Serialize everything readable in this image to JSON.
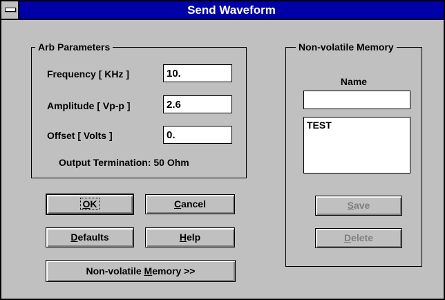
{
  "window": {
    "title": "Send Waveform"
  },
  "arb": {
    "title": "Arb Parameters",
    "frequency": {
      "label": "Frequency [ KHz ]",
      "value": "10."
    },
    "amplitude": {
      "label": "Amplitude [ Vp-p ]",
      "value": "2.6"
    },
    "offset": {
      "label": "Offset [ Volts ]",
      "value": "0."
    },
    "termination": "Output Termination: 50 Ohm"
  },
  "buttons": {
    "ok": {
      "access": "O",
      "rest": "K"
    },
    "cancel": {
      "access": "C",
      "rest": "ancel"
    },
    "defaults": {
      "access": "D",
      "rest": "efaults"
    },
    "help": {
      "access": "H",
      "rest": "elp"
    },
    "nvm": {
      "before": "Non-volatile ",
      "access": "M",
      "rest": "emory >>"
    }
  },
  "nvm": {
    "title": "Non-volatile Memory",
    "name_label": "Name",
    "name_value": "",
    "items": [
      "TEST"
    ],
    "save": {
      "access": "S",
      "rest": "ave"
    },
    "delete": {
      "access": "D",
      "rest": "elete"
    }
  }
}
